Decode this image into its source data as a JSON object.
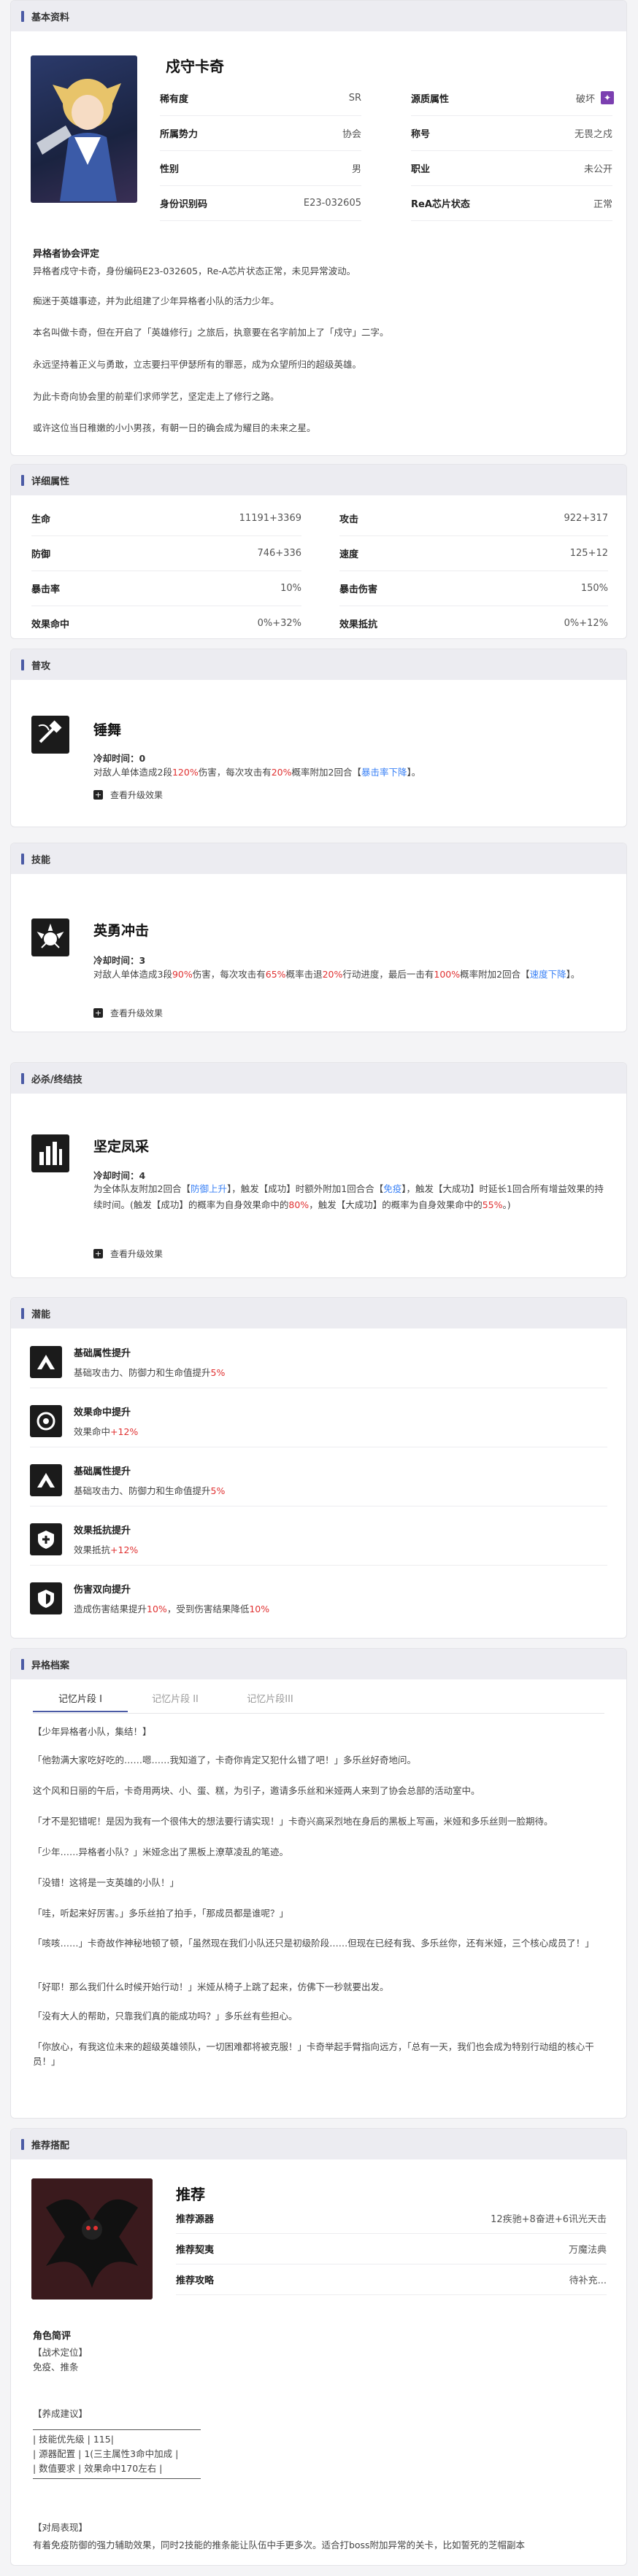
{
  "sections": {
    "basic": "基本资料",
    "attrs": "详细属性",
    "attack": "普攻",
    "skill": "技能",
    "ult": "必杀/终结技",
    "potential": "潜能",
    "archive": "异格档案",
    "recommend": "推荐搭配"
  },
  "profile": {
    "name": "戍守卡奇",
    "fields": [
      {
        "k": "稀有度",
        "v": "SR"
      },
      {
        "k": "源质属性",
        "v": "破坏"
      },
      {
        "k": "所属势力",
        "v": "协会"
      },
      {
        "k": "称号",
        "v": "无畏之戍"
      },
      {
        "k": "性别",
        "v": "男"
      },
      {
        "k": "职业",
        "v": "未公开"
      },
      {
        "k": "身份识别码",
        "v": "E23-032605"
      },
      {
        "k": "ReA芯片状态",
        "v": "正常"
      }
    ],
    "eval_title": "异格者协会评定",
    "eval": [
      "异格者戍守卡奇，身份编码E23-032605，Re-A芯片状态正常，未见异常波动。",
      "痴迷于英雄事迹，并为此组建了少年异格者小队的活力少年。",
      "本名叫做卡奇，但在开启了「英雄修行」之旅后，执意要在名字前加上了「戍守」二字。",
      "永远坚持着正义与勇敢，立志要扫平伊瑟所有的罪恶，成为众望所归的超级英雄。",
      "为此卡奇向协会里的前辈们求师学艺，坚定走上了修行之路。",
      "或许这位当日稚嫩的小小男孩，有朝一日的确会成为耀目的未来之星。"
    ]
  },
  "attrs": [
    [
      "生命",
      "11191+3369",
      "攻击",
      "922+317"
    ],
    [
      "防御",
      "746+336",
      "速度",
      "125+12"
    ],
    [
      "暴击率",
      "10%",
      "暴击伤害",
      "150%"
    ],
    [
      "效果命中",
      "0%+32%",
      "效果抵抗",
      "0%+12%"
    ]
  ],
  "attack": {
    "name": "锤舞",
    "cd_label": "冷却时间：",
    "cd": "0",
    "d1": "对敌人单体造成2段",
    "p1": "120%",
    "d2": "伤害，每次攻击有",
    "p2": "20%",
    "d3": "概率附加2回合【",
    "kw": "暴击率下降",
    "d4": "】。",
    "upgrade": "查看升级效果"
  },
  "skill": {
    "name": "英勇冲击",
    "cd_label": "冷却时间：",
    "cd": "3",
    "d1": "对敌人单体造成3段",
    "p1": "90%",
    "d2": "伤害，每次攻击有",
    "p2": "65%",
    "d3": "概率击退",
    "p3": "20%",
    "d4": "行动进度，最后一击有",
    "p4": "100%",
    "d5": "概率附加2回合【",
    "kw": "速度下降",
    "d6": "】。",
    "upgrade": "查看升级效果"
  },
  "ult": {
    "name": "坚定凤采",
    "cd_label": "冷却时间：",
    "cd": "4",
    "d1": "为全体队友附加2回合【",
    "kw1": "防御上升",
    "d2": "】，触发【成功】时额外附加1回合合【",
    "kw2": "免疫",
    "d3": "】，触发【大成功】时延长1回合所有增益效果的持续时间。(触发【成功】的概率为自身效果命中的",
    "p1": "80%",
    "d4": "，触发【大成功】的概率为自身效果命中的",
    "p2": "55%",
    "d5": "。)",
    "upgrade": "查看升级效果"
  },
  "potentials": [
    {
      "name": "基础属性提升",
      "d1": "基础攻击力、防御力和生命值提升",
      "v": "5%",
      "d2": ""
    },
    {
      "name": "效果命中提升",
      "d1": "效果命中",
      "v": "+12%",
      "d2": ""
    },
    {
      "name": "基础属性提升",
      "d1": "基础攻击力、防御力和生命值提升",
      "v": "5%",
      "d2": ""
    },
    {
      "name": "效果抵抗提升",
      "d1": "效果抵抗",
      "v": "+12%",
      "d2": ""
    },
    {
      "name": "伤害双向提升",
      "d1": "造成伤害结果提升",
      "v": "10%",
      "d2": "，受到伤害结果降低",
      "v2": "10%"
    }
  ],
  "archive": {
    "tabs": [
      "记忆片段 I",
      "记忆片段 II",
      "记忆片段III"
    ],
    "lines": [
      "【少年异格者小队，集结！】",
      "「他勃满大家吃好吃的……嗯……我知道了，卡奇你肯定又犯什么错了吧！」多乐丝好奇地问。",
      "这个风和日丽的午后，卡奇用两块、小、蛋、糕，为引子，邀请多乐丝和米娅两人来到了协会总部的活动室中。",
      "「才不是犯错呢！是因为我有一个很伟大的想法要行请实现！」卡奇兴高采烈地在身后的黑板上写画，米娅和多乐丝则一脸期待。",
      "「少年……异格者小队？」米娅念出了黑板上潦草凌乱的笔迹。",
      "「没错！这将是一支英雄的小队！」",
      "「哇，听起来好厉害。」多乐丝拍了拍手，「那成员都是谁呢？」",
      "「咳咳……」卡奇故作神秘地顿了顿，「虽然现在我们小队还只是初级阶段……但现在已经有我、多乐丝你，还有米娅，三个核心成员了！」",
      "「好耶！那么我们什么时候开始行动！」米娅从椅子上跳了起来，仿佛下一秒就要出发。",
      "「没有大人的帮助，只靠我们真的能成功吗？」多乐丝有些担心。",
      "「你放心，有我这位未来的超级英雄领队，一切困难都将被克服！」卡奇举起手臂指向远方，「总有一天，我们也会成为特别行动组的核心干员！」"
    ]
  },
  "recommend": {
    "title": "推荐",
    "rows": [
      {
        "k": "推荐源器",
        "v": "12疾驰+8奋进+6讯光天击"
      },
      {
        "k": "推荐契夷",
        "v": "万魔法典"
      },
      {
        "k": "推荐攻略",
        "v": "待补充..."
      }
    ],
    "role_title": "角色简评",
    "role": [
      "【战术定位】",
      "免疫、推条",
      "",
      "【养成建议】"
    ],
    "box": [
      "| 技能优先级 | 115|",
      "| 源器配置 | 1(三主属性3命中加成 |",
      "| 数值要求 | 效果命中170左右 |"
    ],
    "tail_title": "【对局表现】",
    "tail": "有着免疫防御的强力辅助效果，同时2技能的推条能让队伍中手更多次。适合打boss附加异常的关卡，比如誓死的芝帽副本"
  }
}
